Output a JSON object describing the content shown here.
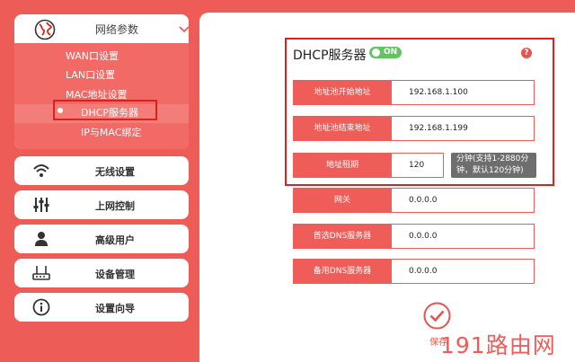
{
  "sidebar": {
    "network": {
      "title": "网络参数",
      "icon": "globe-icon",
      "subitems": [
        "WAN口设置",
        "LAN口设置",
        "MAC地址设置",
        "DHCP服务器",
        "IP与MAC绑定"
      ],
      "active_subitem": "DHCP服务器"
    },
    "items": [
      {
        "label": "无线设置",
        "icon": "wifi-icon"
      },
      {
        "label": "上网控制",
        "icon": "sliders-icon"
      },
      {
        "label": "高级用户",
        "icon": "user-icon"
      },
      {
        "label": "设备管理",
        "icon": "router-icon"
      },
      {
        "label": "设置向导",
        "icon": "info-icon"
      }
    ]
  },
  "dhcp": {
    "title": "DHCP服务器",
    "toggle_label": "ON",
    "help_symbol": "?",
    "fields": {
      "pool_start": {
        "label": "地址池开始地址",
        "value": "192.168.1.100"
      },
      "pool_end": {
        "label": "地址池结束地址",
        "value": "192.168.1.199"
      },
      "lease": {
        "label": "地址租期",
        "value": "120",
        "hint": "分钟(支持1-2880分钟，默认120分钟)"
      },
      "gateway": {
        "label": "网关",
        "value": "0.0.0.0"
      },
      "primary_dns": {
        "label": "首选DNS服务器",
        "value": "0.0.0.0"
      },
      "secondary_dns": {
        "label": "备用DNS服务器",
        "value": "0.0.0.0"
      }
    },
    "save_label": "保存"
  },
  "watermark": "191路由网",
  "colors": {
    "accent": "#ee5c58",
    "highlight": "#e0201a",
    "toggle_on": "#62c462",
    "hint_bg": "#6e6e6e"
  }
}
